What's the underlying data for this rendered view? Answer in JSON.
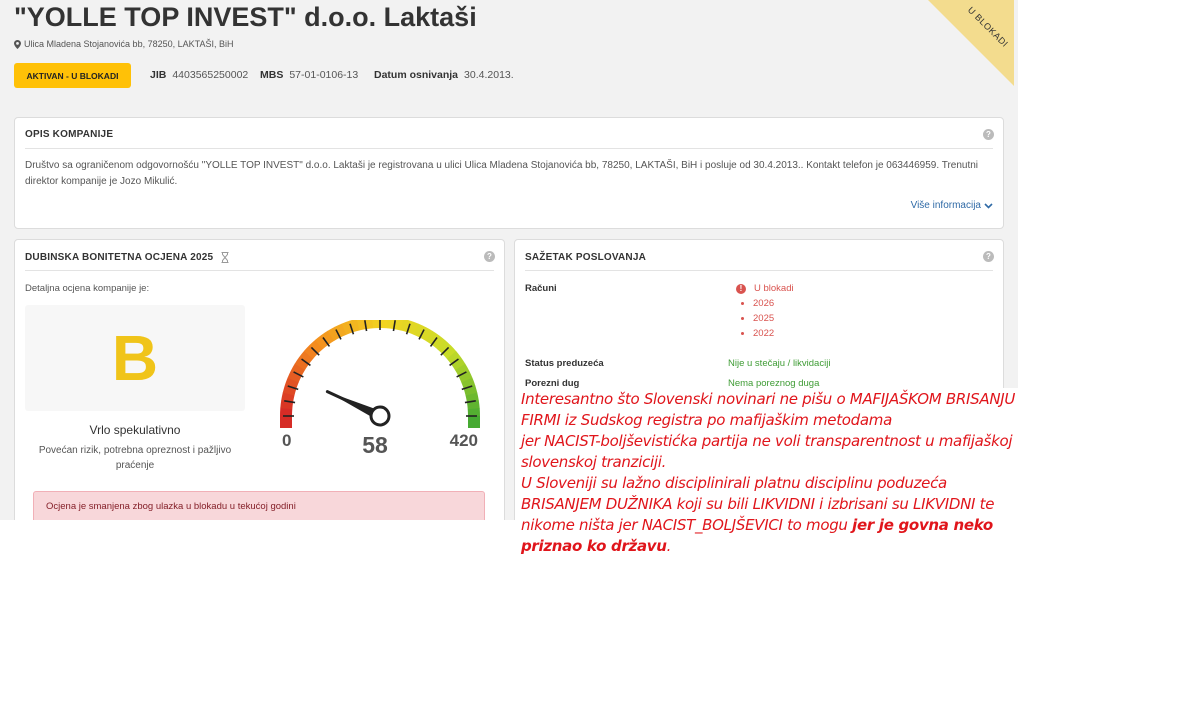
{
  "company": {
    "name": "\"YOLLE TOP INVEST\" d.o.o. Laktaši",
    "address": "Ulica Mladena Stojanovića bb, 78250, LAKTAŠI, BiH",
    "status_button": "AKTIVAN - U BLOKADI",
    "jib_label": "JIB",
    "jib": "4403565250002",
    "mbs_label": "MBS",
    "mbs": "57-01-0106-13",
    "founded_label": "Datum osnivanja",
    "founded": "30.4.2013.",
    "ribbon": "U BLOKADI"
  },
  "description_card": {
    "title": "OPIS KOMPANIJE",
    "text": "Društvo sa ograničenom odgovornošću \"YOLLE TOP INVEST\" d.o.o. Laktaši je registrovana u ulici Ulica Mladena Stojanovića bb, 78250, LAKTAŠI, BiH i posluje od 30.4.2013.. Kontakt telefon je 063446959. Trenutni direktor kompanije je Jozo Mikulić.",
    "more_link": "Više informacija"
  },
  "rating_card": {
    "title": "DUBINSKA BONITETNA OCJENA 2025",
    "intro": "Detaljna ocjena kompanije je:",
    "grade": "B",
    "grade_label": "Vrlo spekulativno",
    "grade_desc": "Povećan rizik, potrebna opreznost i pažljivo praćenje",
    "gauge_min": "0",
    "gauge_max": "420",
    "gauge_value": "58",
    "alert": "Ocjena je smanjena zbog ulazka u blokadu u tekućoj godini"
  },
  "gauge": {
    "min": 0,
    "max": 420,
    "value": 58
  },
  "summary_card": {
    "title": "SAŽETAK POSLOVANJA",
    "accounts_label": "Računi",
    "accounts_status": "U blokadi",
    "years": [
      "2026",
      "2025",
      "2022"
    ],
    "company_status_label": "Status preduzeća",
    "company_status": "Nije u stečaju / likvidaciji",
    "tax_label": "Porezni dug",
    "tax_status": "Nema poreznog duga"
  },
  "annotation": {
    "line1": "Interesantno što Slovenski novinari ne pišu o MAFIJAŠKOM BRISANJU FIRMI iz Sudskog registra po mafijaškim metodama",
    "line2": "jer NACIST-boljševistićka partija ne voli transparentnost u mafijaškoj slovenskoj tranziciji.",
    "line3": "U Sloveniji su lažno disciplinirali platnu disciplinu poduzeća BRISANJEM DUŽNIKA koji su bili LIKVIDNI i izbrisani su LIKVIDNI te nikome ništa jer NACIST_BOLJŠEVICI to mogu ",
    "line3_bold": "jer je govna neko priznao ko državu",
    "line3_end": "."
  },
  "colors": {
    "status_yellow": "#ffc107",
    "grade_yellow": "#f0c419",
    "blocked_red": "#d9534f",
    "ok_green": "#3f9c35",
    "annotation_red": "#e0151b"
  }
}
